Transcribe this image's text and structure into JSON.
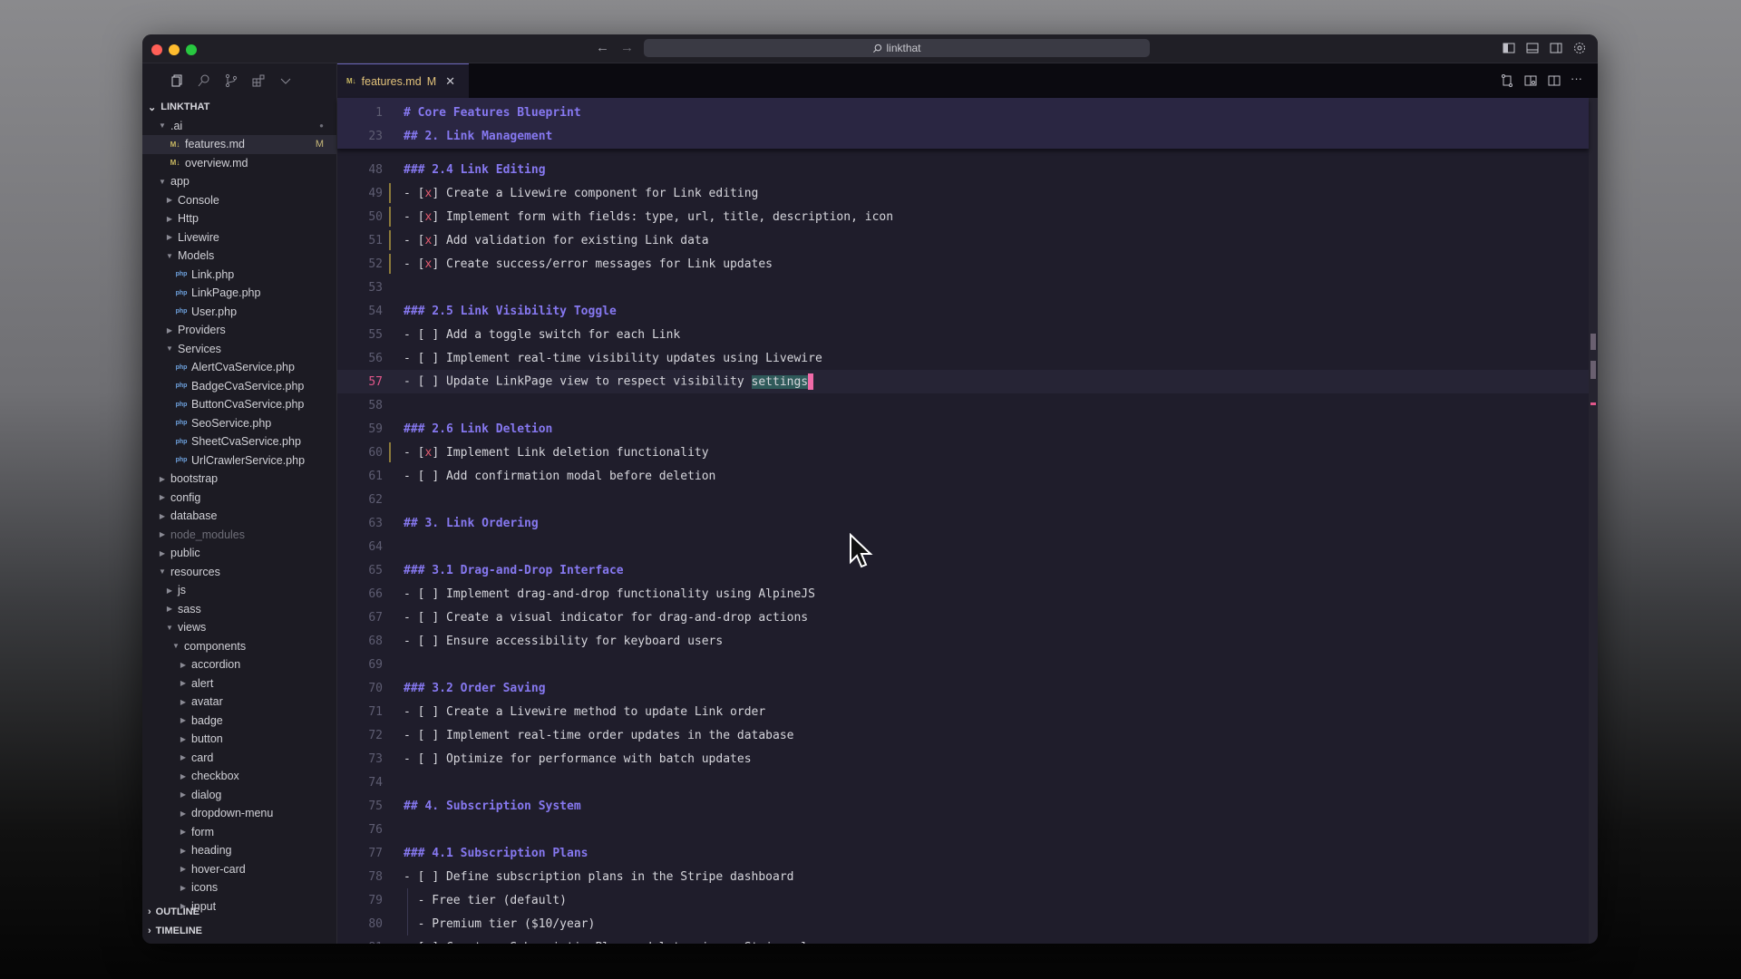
{
  "window": {
    "title_search": "linkthat",
    "traffic_lights": {
      "close": "#ff5f57",
      "minimize": "#febc2e",
      "maximize": "#28c840"
    }
  },
  "titlebar_icons": [
    "toggle-primary-sidebar-icon",
    "toggle-panel-icon",
    "toggle-secondary-sidebar-icon",
    "gear-icon"
  ],
  "activity": [
    "explorer-icon",
    "search-icon",
    "source-control-icon",
    "extensions-icon",
    "chevron-down-icon"
  ],
  "explorer": {
    "root": "LINKTHAT",
    "items": [
      {
        "label": ".ai",
        "depth": 0,
        "type": "folder",
        "open": true,
        "badge": "●"
      },
      {
        "label": "features.md",
        "depth": 1,
        "type": "md",
        "selected": true,
        "badge": "M"
      },
      {
        "label": "overview.md",
        "depth": 1,
        "type": "md"
      },
      {
        "label": "app",
        "depth": 0,
        "type": "folder",
        "open": true
      },
      {
        "label": "Console",
        "depth": 1,
        "type": "folder"
      },
      {
        "label": "Http",
        "depth": 1,
        "type": "folder"
      },
      {
        "label": "Livewire",
        "depth": 1,
        "type": "folder"
      },
      {
        "label": "Models",
        "depth": 1,
        "type": "folder",
        "open": true
      },
      {
        "label": "Link.php",
        "depth": 2,
        "type": "php"
      },
      {
        "label": "LinkPage.php",
        "depth": 2,
        "type": "php"
      },
      {
        "label": "User.php",
        "depth": 2,
        "type": "php"
      },
      {
        "label": "Providers",
        "depth": 1,
        "type": "folder"
      },
      {
        "label": "Services",
        "depth": 1,
        "type": "folder",
        "open": true
      },
      {
        "label": "AlertCvaService.php",
        "depth": 2,
        "type": "php"
      },
      {
        "label": "BadgeCvaService.php",
        "depth": 2,
        "type": "php"
      },
      {
        "label": "ButtonCvaService.php",
        "depth": 2,
        "type": "php"
      },
      {
        "label": "SeoService.php",
        "depth": 2,
        "type": "php"
      },
      {
        "label": "SheetCvaService.php",
        "depth": 2,
        "type": "php"
      },
      {
        "label": "UrlCrawlerService.php",
        "depth": 2,
        "type": "php"
      },
      {
        "label": "bootstrap",
        "depth": 0,
        "type": "folder"
      },
      {
        "label": "config",
        "depth": 0,
        "type": "folder"
      },
      {
        "label": "database",
        "depth": 0,
        "type": "folder"
      },
      {
        "label": "node_modules",
        "depth": 0,
        "type": "folder",
        "dim": true
      },
      {
        "label": "public",
        "depth": 0,
        "type": "folder"
      },
      {
        "label": "resources",
        "depth": 0,
        "type": "folder",
        "open": true
      },
      {
        "label": "js",
        "depth": 1,
        "type": "folder"
      },
      {
        "label": "sass",
        "depth": 1,
        "type": "folder"
      },
      {
        "label": "views",
        "depth": 1,
        "type": "folder",
        "open": true
      },
      {
        "label": "components",
        "depth": 2,
        "type": "folder",
        "open": true
      },
      {
        "label": "accordion",
        "depth": 3,
        "type": "folder"
      },
      {
        "label": "alert",
        "depth": 3,
        "type": "folder"
      },
      {
        "label": "avatar",
        "depth": 3,
        "type": "folder"
      },
      {
        "label": "badge",
        "depth": 3,
        "type": "folder"
      },
      {
        "label": "button",
        "depth": 3,
        "type": "folder"
      },
      {
        "label": "card",
        "depth": 3,
        "type": "folder"
      },
      {
        "label": "checkbox",
        "depth": 3,
        "type": "folder"
      },
      {
        "label": "dialog",
        "depth": 3,
        "type": "folder"
      },
      {
        "label": "dropdown-menu",
        "depth": 3,
        "type": "folder"
      },
      {
        "label": "form",
        "depth": 3,
        "type": "folder"
      },
      {
        "label": "heading",
        "depth": 3,
        "type": "folder"
      },
      {
        "label": "hover-card",
        "depth": 3,
        "type": "folder"
      },
      {
        "label": "icons",
        "depth": 3,
        "type": "folder"
      },
      {
        "label": "input",
        "depth": 3,
        "type": "folder"
      }
    ],
    "sections": [
      "OUTLINE",
      "TIMELINE"
    ]
  },
  "tab": {
    "label": "features.md",
    "status": "M",
    "close": "✕"
  },
  "editor_actions": [
    "open-changes-icon",
    "open-preview-icon",
    "split-editor-icon",
    "more-actions-icon"
  ],
  "sticky": [
    {
      "n": "1",
      "text": "# Core Features Blueprint",
      "kind": "h"
    },
    {
      "n": "23",
      "text": "## 2. Link Management",
      "kind": "h"
    }
  ],
  "lines": [
    {
      "n": "48",
      "text": "### 2.4 Link Editing",
      "kind": "h"
    },
    {
      "n": "49",
      "text": "Create a Livewire component for Link editing",
      "kind": "x",
      "mod": true
    },
    {
      "n": "50",
      "text": "Implement form with fields: type, url, title, description, icon",
      "kind": "x",
      "mod": true
    },
    {
      "n": "51",
      "text": "Add validation for existing Link data",
      "kind": "x",
      "mod": true
    },
    {
      "n": "52",
      "text": "Create success/error messages for Link updates",
      "kind": "x",
      "mod": true
    },
    {
      "n": "53",
      "text": "",
      "kind": "t"
    },
    {
      "n": "54",
      "text": "### 2.5 Link Visibility Toggle",
      "kind": "h"
    },
    {
      "n": "55",
      "text": "Add a toggle switch for each Link",
      "kind": "o"
    },
    {
      "n": "56",
      "text": "Implement real-time visibility updates using Livewire",
      "kind": "o"
    },
    {
      "n": "57",
      "text": "Update LinkPage view to respect visibility ",
      "kind": "o",
      "current": true,
      "selected": "settings"
    },
    {
      "n": "58",
      "text": "",
      "kind": "t"
    },
    {
      "n": "59",
      "text": "### 2.6 Link Deletion",
      "kind": "h"
    },
    {
      "n": "60",
      "text": "Implement Link deletion functionality",
      "kind": "x",
      "mod": true
    },
    {
      "n": "61",
      "text": "Add confirmation modal before deletion",
      "kind": "o"
    },
    {
      "n": "62",
      "text": "",
      "kind": "t"
    },
    {
      "n": "63",
      "text": "## 3. Link Ordering",
      "kind": "h"
    },
    {
      "n": "64",
      "text": "",
      "kind": "t"
    },
    {
      "n": "65",
      "text": "### 3.1 Drag-and-Drop Interface",
      "kind": "h"
    },
    {
      "n": "66",
      "text": "Implement drag-and-drop functionality using AlpineJS",
      "kind": "o"
    },
    {
      "n": "67",
      "text": "Create a visual indicator for drag-and-drop actions",
      "kind": "o"
    },
    {
      "n": "68",
      "text": "Ensure accessibility for keyboard users",
      "kind": "o"
    },
    {
      "n": "69",
      "text": "",
      "kind": "t"
    },
    {
      "n": "70",
      "text": "### 3.2 Order Saving",
      "kind": "h"
    },
    {
      "n": "71",
      "text": "Create a Livewire method to update Link order",
      "kind": "o"
    },
    {
      "n": "72",
      "text": "Implement real-time order updates in the database",
      "kind": "o"
    },
    {
      "n": "73",
      "text": "Optimize for performance with batch updates",
      "kind": "o"
    },
    {
      "n": "74",
      "text": "",
      "kind": "t"
    },
    {
      "n": "75",
      "text": "## 4. Subscription System",
      "kind": "h"
    },
    {
      "n": "76",
      "text": "",
      "kind": "t"
    },
    {
      "n": "77",
      "text": "### 4.1 Subscription Plans",
      "kind": "h"
    },
    {
      "n": "78",
      "text": "Define subscription plans in the Stripe dashboard",
      "kind": "o"
    },
    {
      "n": "79",
      "text": "  - Free tier (default)",
      "kind": "t",
      "guide": true
    },
    {
      "n": "80",
      "text": "  - Premium tier ($10/year)",
      "kind": "t",
      "guide": true
    },
    {
      "n": "81",
      "text": "Create a SubscriptionPlan model to mirror Stripe plans",
      "kind": "o"
    }
  ],
  "colors": {
    "heading": "#8678f0",
    "checked_x": "#e35b6f",
    "caret": "#f06aa8",
    "md_icon": "#c9b862",
    "php_icon": "#6fa3e0"
  }
}
